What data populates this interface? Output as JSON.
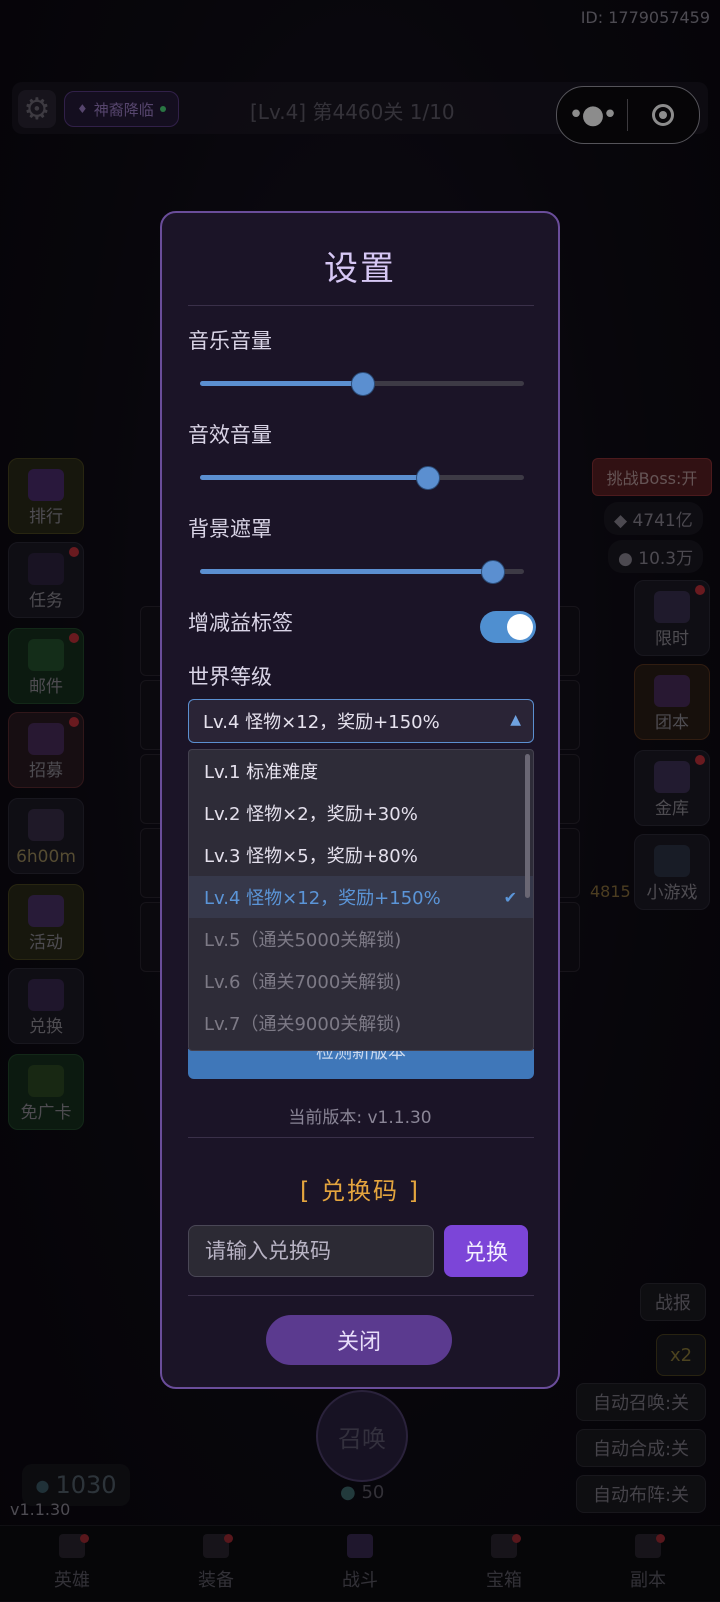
{
  "header": {
    "id_text": "ID: 1779057459",
    "event_badge": "神裔降临",
    "level_title": "[Lv.4] 第4460关 1/10"
  },
  "left_menu": [
    {
      "label": "排行"
    },
    {
      "label": "任务"
    },
    {
      "label": "邮件"
    },
    {
      "label": "招募"
    },
    {
      "label": "6h00m"
    },
    {
      "label": "活动"
    },
    {
      "label": "兑换"
    },
    {
      "label": "免广卡"
    }
  ],
  "right_panel": {
    "boss_toggle": "挑战Boss:开",
    "resource1": "4741亿",
    "resource2": "10.3万",
    "side_count": "4815",
    "items": [
      {
        "label": "限时"
      },
      {
        "label": "团本"
      },
      {
        "label": "金库"
      },
      {
        "label": "小游戏"
      }
    ],
    "battle_report": "战报",
    "speed": "x2",
    "auto_summon": "自动召唤:关",
    "auto_merge": "自动合成:关",
    "auto_deploy": "自动布阵:关"
  },
  "bottom": {
    "gems": "1030",
    "version": "v1.1.30",
    "summon_label": "召唤",
    "summon_cost": "50",
    "nav": [
      {
        "label": "英雄"
      },
      {
        "label": "装备"
      },
      {
        "label": "战斗"
      },
      {
        "label": "宝箱"
      },
      {
        "label": "副本"
      }
    ]
  },
  "settings": {
    "title": "设置",
    "music_volume_label": "音乐音量",
    "music_volume": 0.5,
    "sfx_volume_label": "音效音量",
    "sfx_volume": 0.7,
    "bg_mask_label": "背景遮罩",
    "bg_mask": 0.9,
    "buff_tags_label": "增减益标签",
    "buff_tags_on": true,
    "world_level_label": "世界等级",
    "world_level_selected": "Lv.4  怪物×12，奖励+150%",
    "world_level_options": [
      {
        "label": "Lv.1  标准难度",
        "state": "normal"
      },
      {
        "label": "Lv.2  怪物×2，奖励+30%",
        "state": "normal"
      },
      {
        "label": "Lv.3  怪物×5，奖励+80%",
        "state": "normal"
      },
      {
        "label": "Lv.4  怪物×12，奖励+150%",
        "state": "selected"
      },
      {
        "label": "Lv.5（通关5000关解锁)",
        "state": "disabled"
      },
      {
        "label": "Lv.6（通关7000关解锁)",
        "state": "disabled"
      },
      {
        "label": "Lv.7（通关9000关解锁)",
        "state": "disabled"
      }
    ],
    "check_update_label": "检测新版本",
    "current_version": "当前版本: v1.1.30",
    "redeem_title": "[ 兑换码 ]",
    "redeem_placeholder": "请输入兑换码",
    "redeem_button": "兑换",
    "close_button": "关闭"
  },
  "colors": {
    "accent_blue": "#5b8fd0",
    "accent_purple": "#7c45d8",
    "gold": "#e4a53e"
  }
}
